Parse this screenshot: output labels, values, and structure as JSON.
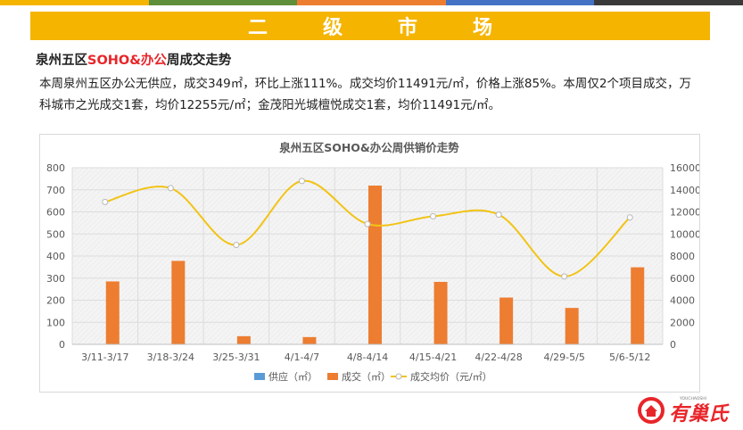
{
  "colors": {
    "banner": "#f5b400",
    "accent_red": "#e8262a",
    "bar_supply": "#5b9bd5",
    "bar_deal": "#ed7d31",
    "line_price": "#f2c314",
    "top_stripes": [
      "#f5b400",
      "#5f8f3a",
      "#ed7d31",
      "#4472c4",
      "#3a3a3a"
    ]
  },
  "banner": {
    "title": "二级市场"
  },
  "section": {
    "title_pre": "泉州五区",
    "title_highlight": "SOHO&办公",
    "title_post": "周成交走势"
  },
  "paragraph": {
    "line1": "本周泉州五区办公无供应，成交349㎡，环比上涨111%。成交均价11491元/㎡，价格上涨85%。本周仅2个项目成交，万",
    "line2": "科城市之光成交1套，均价12255元/㎡；金茂阳光城檀悦成交1套，均价11491元/㎡。"
  },
  "logo": {
    "text": "有巢氏",
    "small_text": "YOUCHAOSHI",
    "icon": "house-in-circle-icon"
  },
  "chart_data": {
    "type": "bar",
    "title": "泉州五区SOHO&办公周供销价走势",
    "categories": [
      "3/11-3/17",
      "3/18-3/24",
      "3/25-3/31",
      "4/1-4/7",
      "4/8-4/14",
      "4/15-4/21",
      "4/22-4/28",
      "4/29-5/5",
      "5/6-5/12"
    ],
    "series": [
      {
        "name": "供应（㎡）",
        "type": "bar",
        "axis": "left",
        "values": [
          0,
          0,
          0,
          0,
          0,
          0,
          0,
          0,
          0
        ]
      },
      {
        "name": "成交（㎡）",
        "type": "bar",
        "axis": "left",
        "values": [
          285,
          378,
          37,
          33,
          719,
          283,
          212,
          165,
          349
        ]
      },
      {
        "name": "成交均价（元/㎡）",
        "type": "line",
        "axis": "right",
        "values": [
          12900,
          14150,
          9000,
          14800,
          10900,
          11600,
          11750,
          6150,
          11491
        ]
      }
    ],
    "ylim": [
      0,
      800
    ],
    "y_ticks": [
      0,
      100,
      200,
      300,
      400,
      500,
      600,
      700,
      800
    ],
    "y2lim": [
      0,
      16000
    ],
    "y2_ticks": [
      0,
      2000,
      4000,
      6000,
      8000,
      10000,
      12000,
      14000,
      16000
    ],
    "grid": true,
    "legend_position": "bottom"
  }
}
